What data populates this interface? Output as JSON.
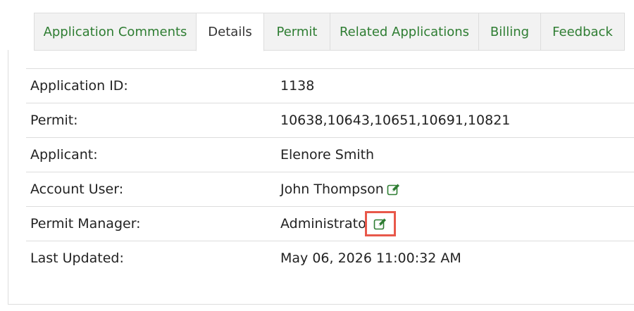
{
  "tabs": [
    {
      "label": "Application Comments",
      "active": false
    },
    {
      "label": "Details",
      "active": true
    },
    {
      "label": "Permit",
      "active": false
    },
    {
      "label": "Related Applications",
      "active": false
    },
    {
      "label": "Billing",
      "active": false
    },
    {
      "label": "Feedback",
      "active": false
    }
  ],
  "details": {
    "application_id": {
      "label": "Application ID:",
      "value": "1138"
    },
    "permit": {
      "label": "Permit:",
      "value": "10638,10643,10651,10691,10821"
    },
    "applicant": {
      "label": "Applicant:",
      "value": "Elenore Smith"
    },
    "account_user": {
      "label": "Account User:",
      "value": "John Thompson",
      "icon": "edit-icon"
    },
    "permit_manager": {
      "label": "Permit Manager:",
      "value": "Administrator",
      "icon": "edit-icon",
      "highlighted": true
    },
    "last_updated": {
      "label": "Last Updated:",
      "value": "May 06, 2026 11:00:32 AM"
    }
  },
  "colors": {
    "tab_text": "#2e7d32",
    "icon": "#2e7d32",
    "highlight_border": "#e8584a"
  }
}
